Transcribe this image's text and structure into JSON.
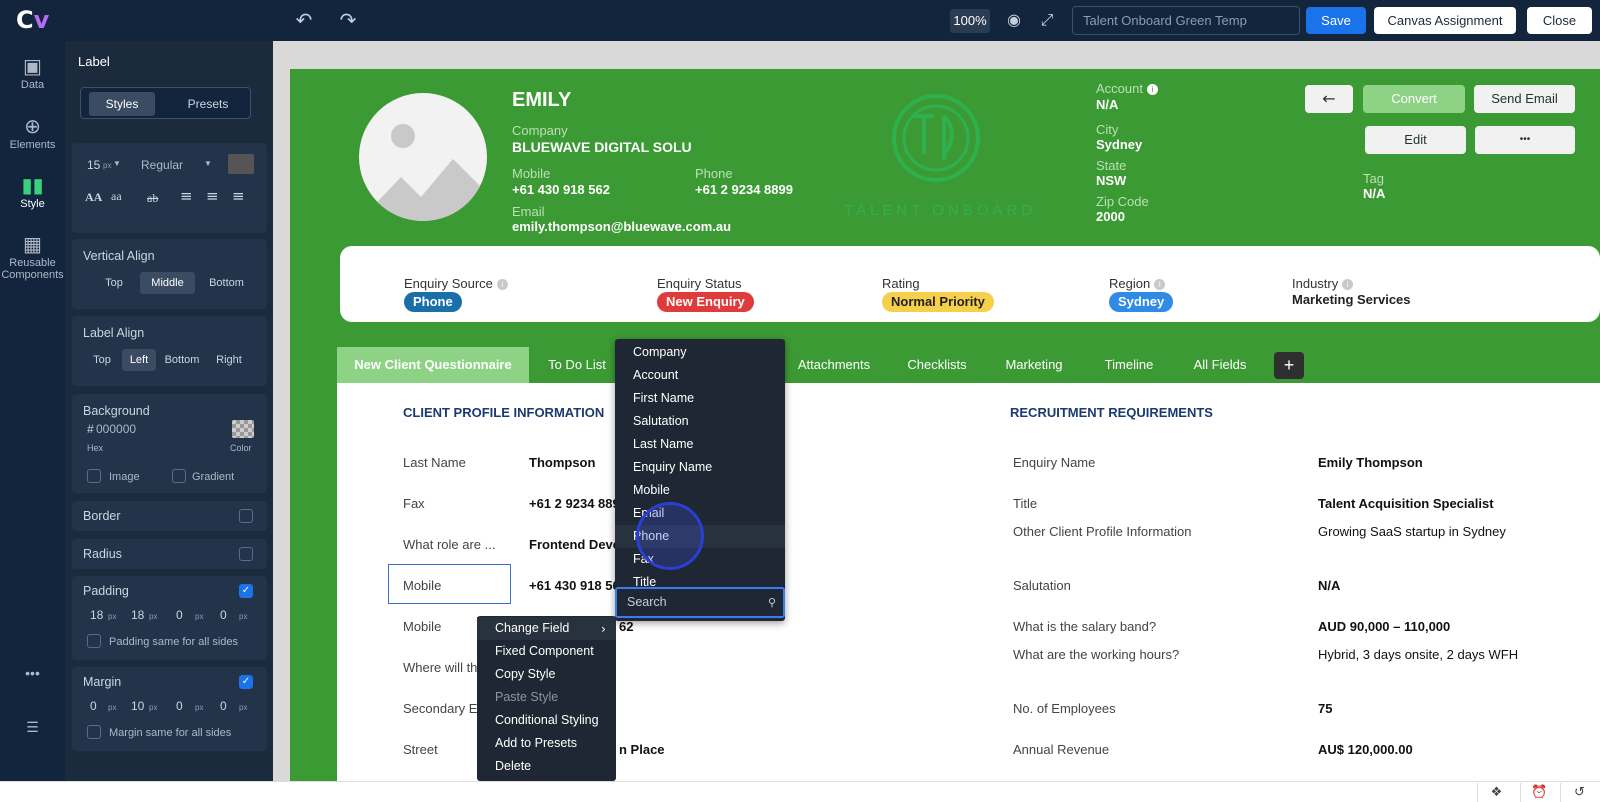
{
  "toolbar": {
    "logo_text": "C",
    "logo_v": "v",
    "zoom": "100%",
    "layout_name_placeholder": "Talent Onboard Green Temp",
    "save_label": "Save",
    "canvas_assignment_label": "Canvas Assignment",
    "close_label": "Close"
  },
  "leftnav": {
    "items": [
      {
        "label": "Data",
        "icon": "data-icon"
      },
      {
        "label": "Elements",
        "icon": "plus-circle-icon"
      },
      {
        "label": "Style",
        "icon": "style-icon"
      },
      {
        "label": "Reusable Components",
        "icon": "components-icon"
      }
    ]
  },
  "panel": {
    "title": "Label",
    "tabs": [
      "Styles",
      "Presets"
    ],
    "font_size": "15",
    "font_size_unit": "px",
    "font_weight": "Regular",
    "font_color": "#555555",
    "text_case_upper": "AA",
    "text_case_lower": "aa",
    "strike": "ab",
    "vertical_align": {
      "title": "Vertical Align",
      "options": [
        "Top",
        "Middle",
        "Bottom"
      ],
      "selected": "Middle"
    },
    "label_align": {
      "title": "Label Align",
      "options": [
        "Top",
        "Left",
        "Bottom",
        "Right"
      ],
      "selected": "Left"
    },
    "background": {
      "title": "Background",
      "hex": "000000",
      "hex_label": "Hex",
      "color_label": "Color",
      "image_label": "Image",
      "gradient_label": "Gradient"
    },
    "border_title": "Border",
    "radius_title": "Radius",
    "padding": {
      "title": "Padding",
      "values": [
        "18",
        "18",
        "0",
        "0"
      ],
      "unit": "px",
      "same_label": "Padding same for all sides"
    },
    "margin": {
      "title": "Margin",
      "values": [
        "0",
        "10",
        "0",
        "0"
      ],
      "unit": "px",
      "same_label": "Margin same for all sides"
    }
  },
  "header": {
    "name": "EMILY",
    "company_label": "Company",
    "company": "BLUEWAVE DIGITAL SOLU",
    "mobile_label": "Mobile",
    "mobile": "+61 430 918 562",
    "phone_label": "Phone",
    "phone": "+61 2 9234 8899",
    "email_label": "Email",
    "email": "emily.thompson@bluewave.com.au",
    "watermark_text": "TALENT ONBOARD",
    "account_label": "Account",
    "account": "N/A",
    "city_label": "City",
    "city": "Sydney",
    "state_label": "State",
    "state": "NSW",
    "zip_label": "Zip Code",
    "zip": "2000",
    "tag_label": "Tag",
    "tag": "N/A",
    "back_icon": "←",
    "convert_label": "Convert",
    "send_email_label": "Send Email",
    "edit_label": "Edit",
    "more_label": "•••"
  },
  "summary": {
    "enquiry_source_label": "Enquiry Source",
    "enquiry_source": "Phone",
    "enquiry_status_label": "Enquiry Status",
    "enquiry_status": "New Enquiry",
    "rating_label": "Rating",
    "rating": "Normal Priority",
    "region_label": "Region",
    "region": "Sydney",
    "industry_label": "Industry",
    "industry": "Marketing Services",
    "colors": {
      "source": "#1a6fa8",
      "status": "#e03b3b",
      "rating": "#f6cf4b",
      "region": "#2f8be6"
    }
  },
  "tabs": [
    "New Client Questionnaire",
    "To Do List",
    "Attachments",
    "Checklists",
    "Marketing",
    "Timeline",
    "All Fields"
  ],
  "tab_add": "+",
  "left_section": {
    "title": "CLIENT PROFILE INFORMATION",
    "rows": [
      {
        "label": "Last Name",
        "value": "Thompson"
      },
      {
        "label": "Fax",
        "value": "+61 2 9234 889"
      },
      {
        "label": "What role are ...",
        "value": "Frontend Deve"
      },
      {
        "label": "Mobile",
        "value": "+61 430 918 56"
      },
      {
        "label": "Mobile",
        "value": "62"
      },
      {
        "label": "Where will th",
        "value": ""
      },
      {
        "label": "Secondary E",
        "value": ""
      },
      {
        "label": "Street",
        "value": "n Place"
      }
    ]
  },
  "right_section": {
    "title": "RECRUITMENT REQUIREMENTS",
    "rows": [
      {
        "label": "Enquiry Name",
        "value": "Emily Thompson"
      },
      {
        "label": "Title",
        "value": "Talent Acquisition Specialist"
      },
      {
        "label": "Other Client Profile Information",
        "value": "Growing SaaS startup in Sydney"
      },
      {
        "label": "Salutation",
        "value": "N/A"
      },
      {
        "label": "What is the salary band?",
        "value": "AUD 90,000 – 110,000"
      },
      {
        "label": "What are the working hours?",
        "value": "Hybrid, 3 days onsite, 2 days WFH"
      },
      {
        "label": "No. of Employees",
        "value": "75"
      },
      {
        "label": "Annual Revenue",
        "value": "AU$ 120,000.00"
      }
    ]
  },
  "field_dropdown": {
    "items": [
      "Company",
      "Account",
      "First Name",
      "Salutation",
      "Last Name",
      "Enquiry Name",
      "Mobile",
      "Email",
      "Phone",
      "Fax",
      "Title"
    ],
    "highlighted": "Phone",
    "search_placeholder": "Search"
  },
  "context_menu": {
    "items": [
      "Change Field",
      "Fixed Component",
      "Copy Style",
      "Paste Style",
      "Conditional Styling",
      "Add to Presets",
      "Delete"
    ],
    "disabled": [
      "Paste Style"
    ]
  }
}
